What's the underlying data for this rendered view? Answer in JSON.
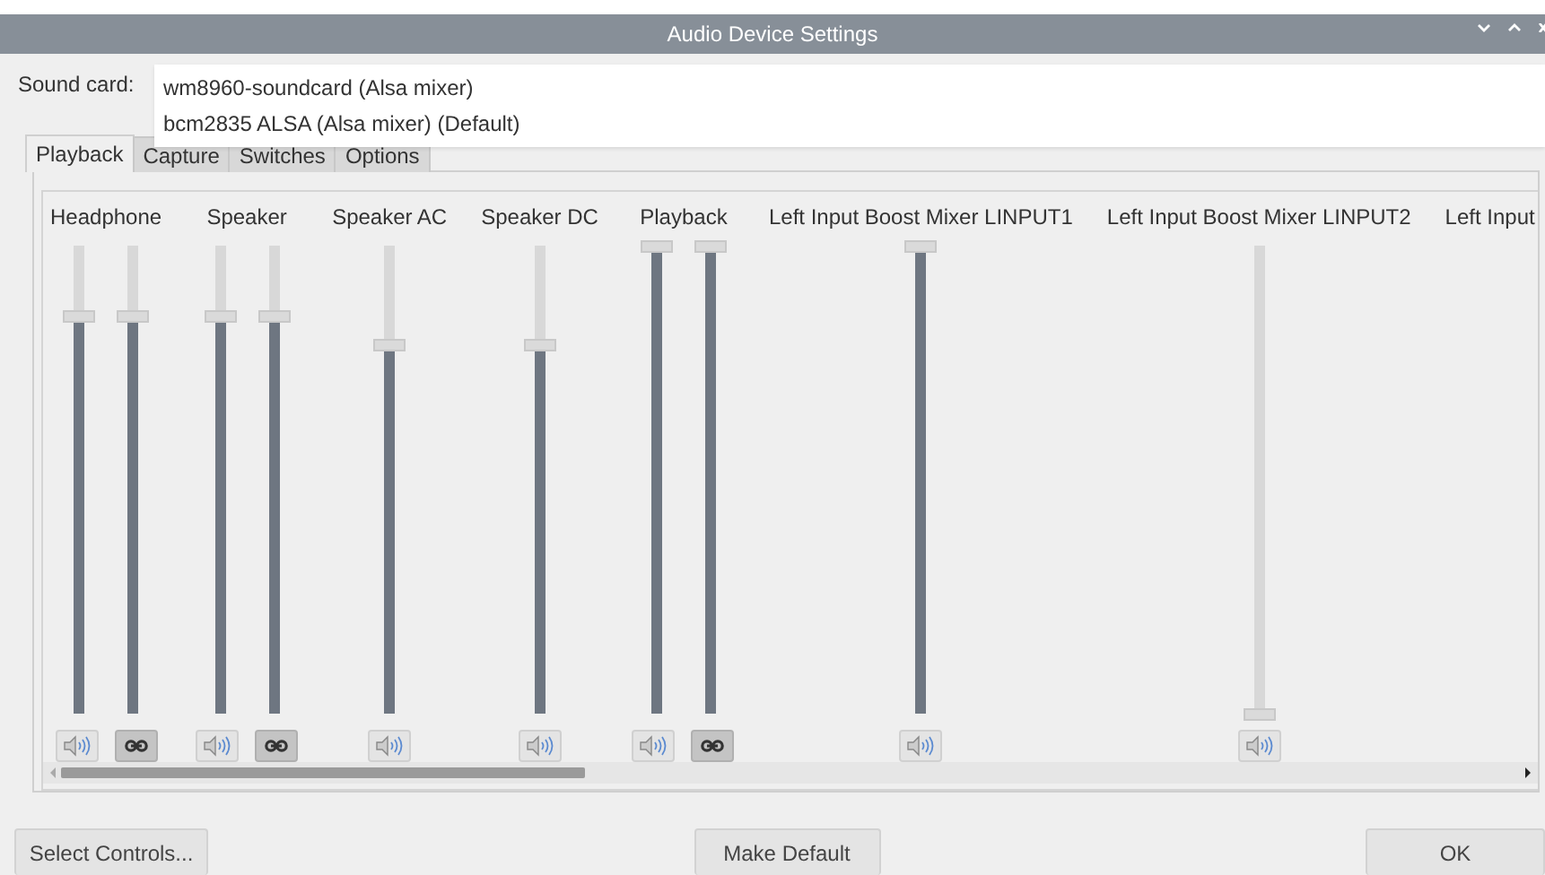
{
  "window": {
    "title": "Audio Device Settings"
  },
  "sound_card": {
    "label": "Sound card:",
    "options": [
      {
        "label": "wm8960-soundcard (Alsa mixer)"
      },
      {
        "label": "bcm2835 ALSA (Alsa mixer) (Default)"
      }
    ]
  },
  "tabs": [
    {
      "label": "Playback",
      "selected": true
    },
    {
      "label": "Capture",
      "selected": false
    },
    {
      "label": "Switches",
      "selected": false
    },
    {
      "label": "Options",
      "selected": false
    }
  ],
  "channels": [
    {
      "name": "Headphone",
      "sliders": [
        {
          "level": 0.85
        },
        {
          "level": 0.85
        }
      ],
      "muted": false,
      "linked": true
    },
    {
      "name": "Speaker",
      "sliders": [
        {
          "level": 0.85
        },
        {
          "level": 0.85
        }
      ],
      "muted": false,
      "linked": true
    },
    {
      "name": "Speaker AC",
      "sliders": [
        {
          "level": 0.79
        }
      ],
      "muted": false,
      "linked": false
    },
    {
      "name": "Speaker DC",
      "sliders": [
        {
          "level": 0.79
        }
      ],
      "muted": false,
      "linked": false
    },
    {
      "name": "Playback",
      "sliders": [
        {
          "level": 1
        },
        {
          "level": 1
        }
      ],
      "muted": false,
      "linked": true
    },
    {
      "name": "Left Input Boost Mixer LINPUT1",
      "sliders": [
        {
          "level": 1
        }
      ],
      "muted": false,
      "linked": false
    },
    {
      "name": "Left Input Boost Mixer LINPUT2",
      "sliders": [
        {
          "level": 0
        }
      ],
      "muted": false,
      "linked": false
    },
    {
      "name": "Left Input"
    }
  ],
  "buttons": [
    {
      "label": "Select Controls..."
    },
    {
      "label": "Make Default"
    },
    {
      "label": "OK"
    }
  ]
}
